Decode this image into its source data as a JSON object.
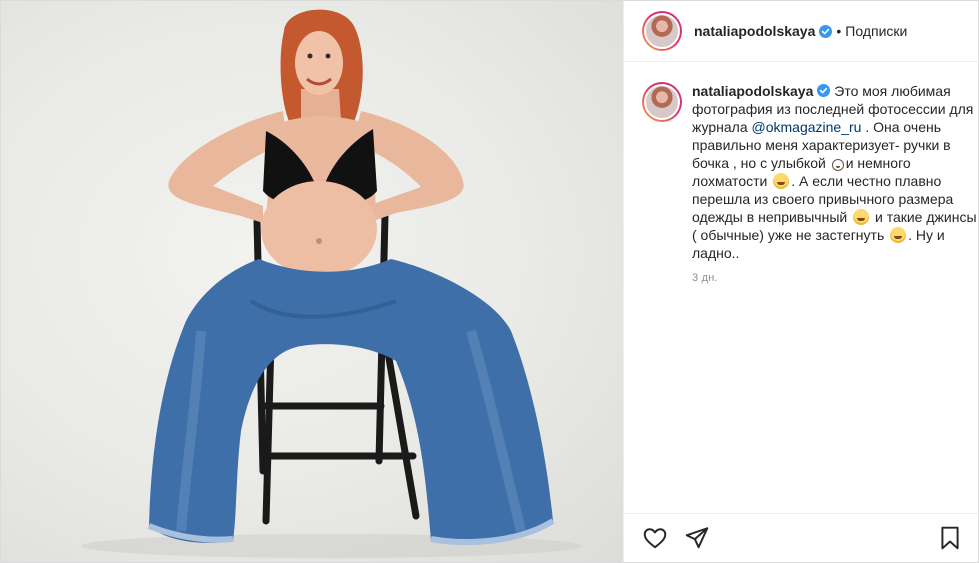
{
  "post": {
    "author": {
      "username": "nataliapodolskaya",
      "verified": true,
      "follow_label": "Подписки",
      "separator": "•"
    },
    "caption": {
      "username": "nataliapodolskaya",
      "text_1": "Это моя любимая фотография из последней фотосессии для журнала ",
      "mention": "@okmagazine_ru",
      "text_2": " . Она очень правильно меня характеризует- ручки в бочка , но с улыбкой ",
      "text_3": "и немного лохматости ",
      "text_4": ". А если честно плавно перешла из своего привычного размера одежды в непривычный ",
      "text_5": " и такие джинсы ( обычные) уже не застегнуть ",
      "text_6": ". Ну и ладно..",
      "time": "3 дн."
    },
    "actions": [
      {
        "name": "like",
        "icon": "heart-icon"
      },
      {
        "name": "share",
        "icon": "paper-plane-icon"
      },
      {
        "name": "save",
        "icon": "bookmark-icon"
      }
    ]
  },
  "colors": {
    "text": "#262626",
    "muted": "#8e8e8e",
    "mention": "#00376b",
    "verified": "#3897f0",
    "border": "#dbdbdb"
  }
}
